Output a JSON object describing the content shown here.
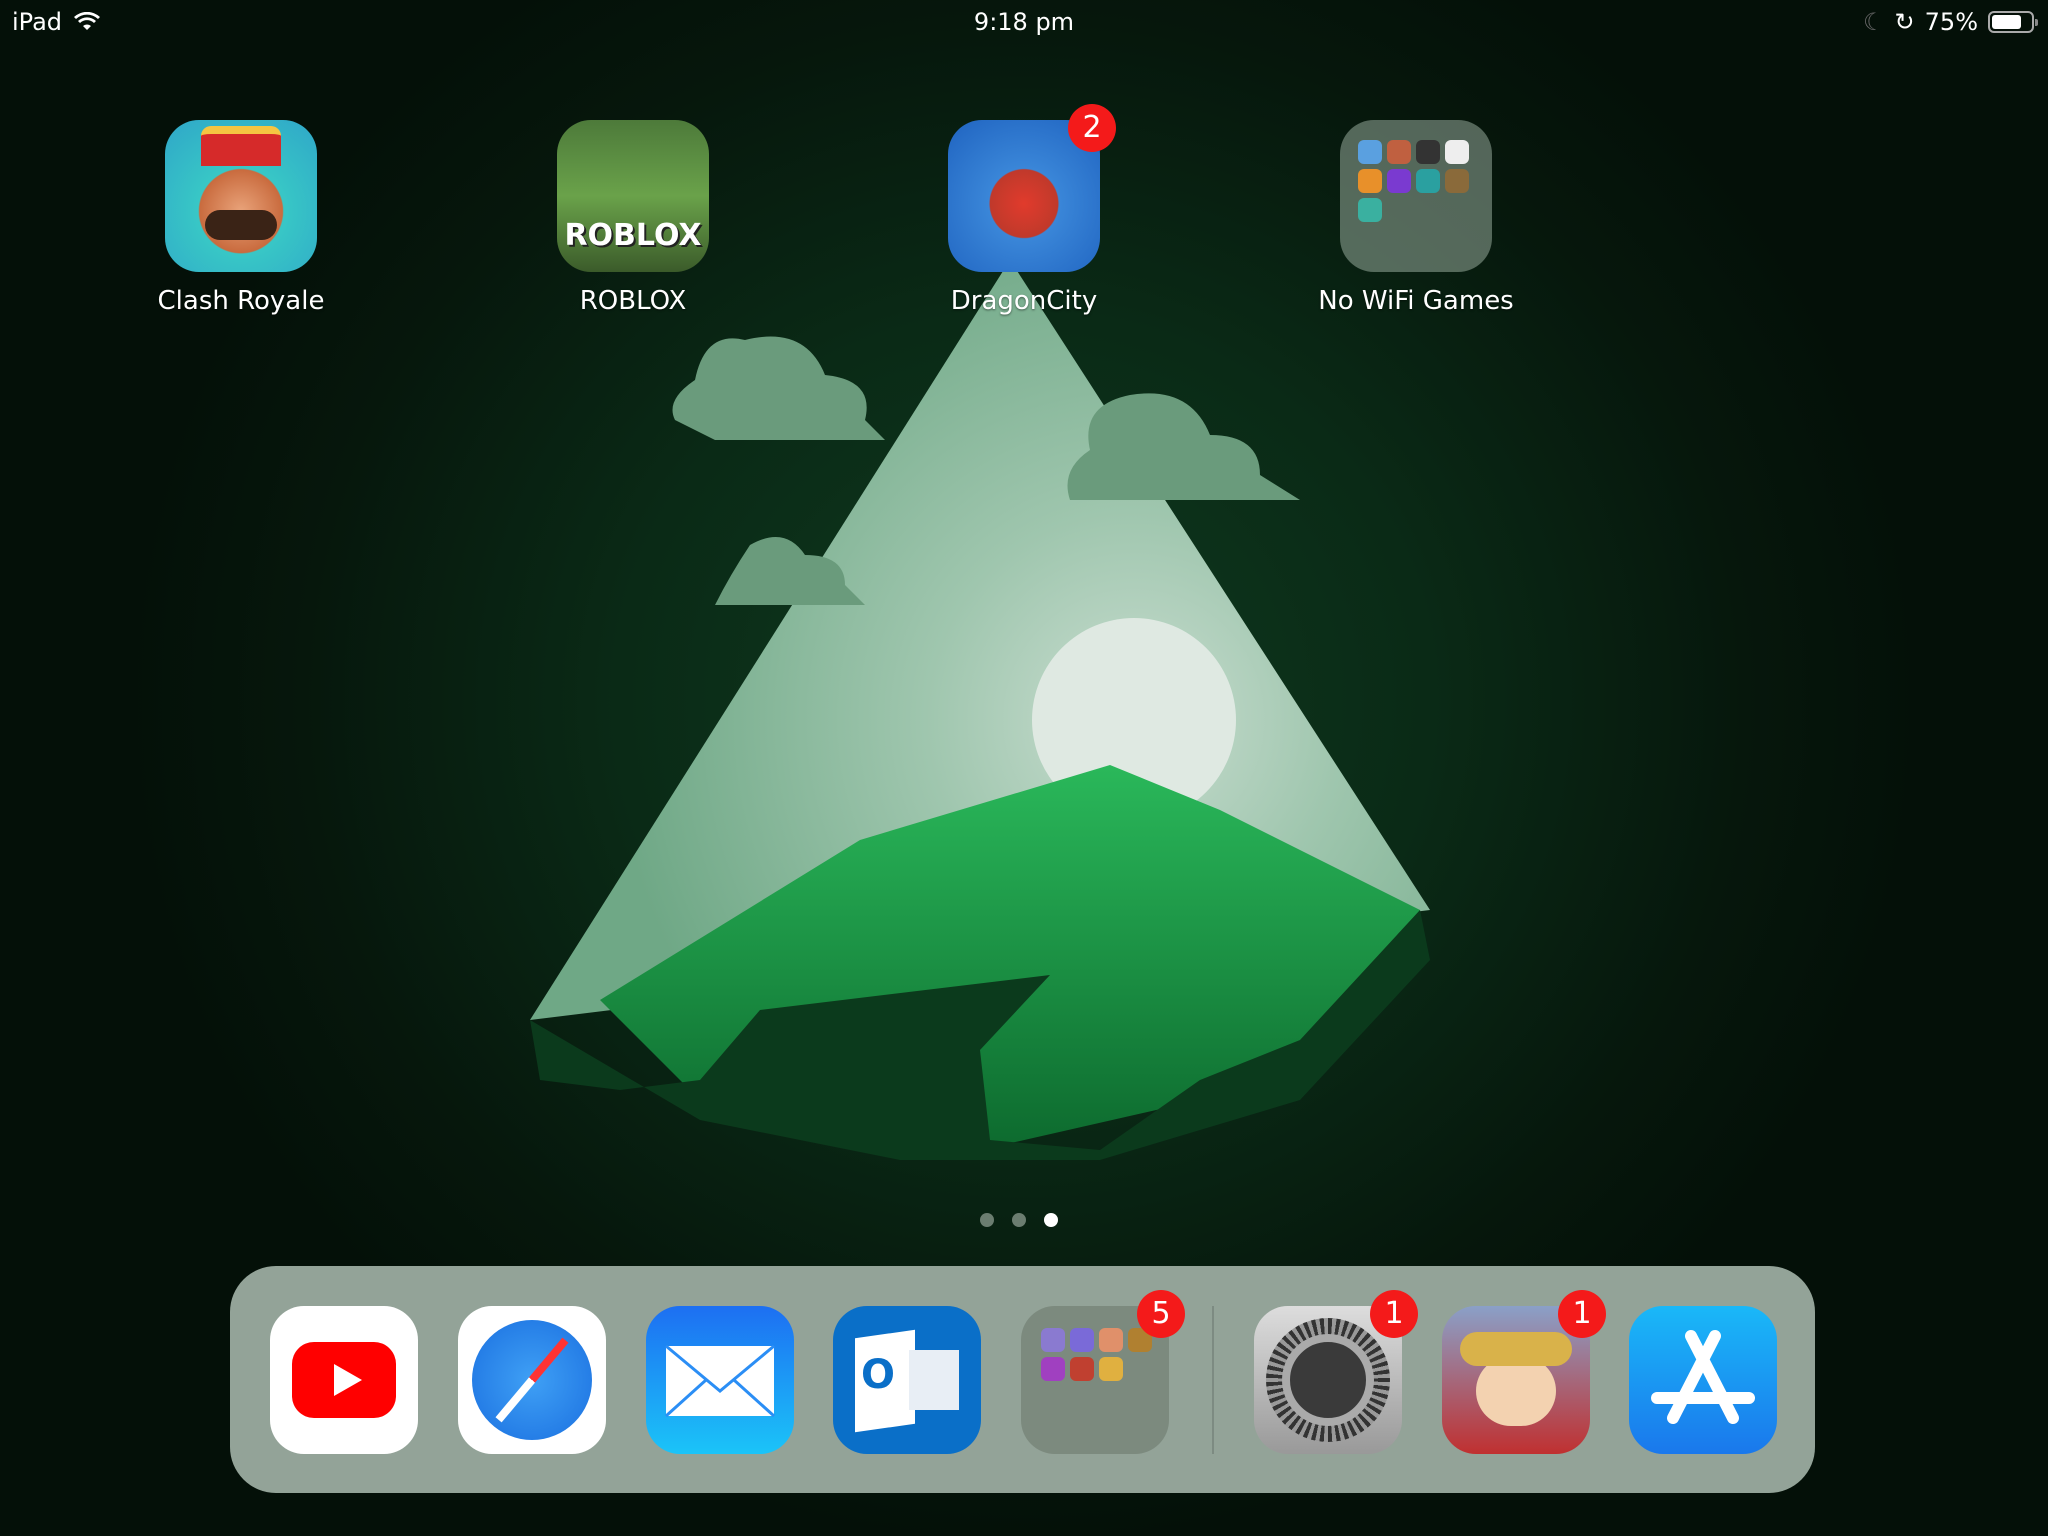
{
  "status_bar": {
    "device": "iPad",
    "time": "9:18 pm",
    "battery_percent_label": "75%",
    "battery_level": 0.75,
    "icons": [
      "wifi-icon",
      "moon-icon",
      "rotation-lock-icon",
      "battery-icon"
    ]
  },
  "home_apps": [
    {
      "label": "Clash Royale",
      "badge": null
    },
    {
      "label": "ROBLOX",
      "badge": null,
      "icon_text": "ROBLOX"
    },
    {
      "label": "DragonCity",
      "badge": "2"
    },
    {
      "label": "No WiFi Games",
      "badge": null,
      "type": "folder"
    }
  ],
  "page_indicator": {
    "pages": 3,
    "current": 3
  },
  "dock": {
    "apps": [
      {
        "name": "YouTube",
        "badge": null
      },
      {
        "name": "Safari",
        "badge": null
      },
      {
        "name": "Mail",
        "badge": null
      },
      {
        "name": "Outlook",
        "badge": null,
        "icon_text": "O"
      },
      {
        "name": "Folder",
        "badge": "5"
      },
      {
        "name": "Settings",
        "badge": "1"
      },
      {
        "name": "South Park",
        "badge": "1"
      },
      {
        "name": "App Store",
        "badge": null
      }
    ]
  },
  "colors": {
    "badge": "#f41a1a",
    "dock": "#93a398",
    "wallpaper": "#0a2a16"
  }
}
